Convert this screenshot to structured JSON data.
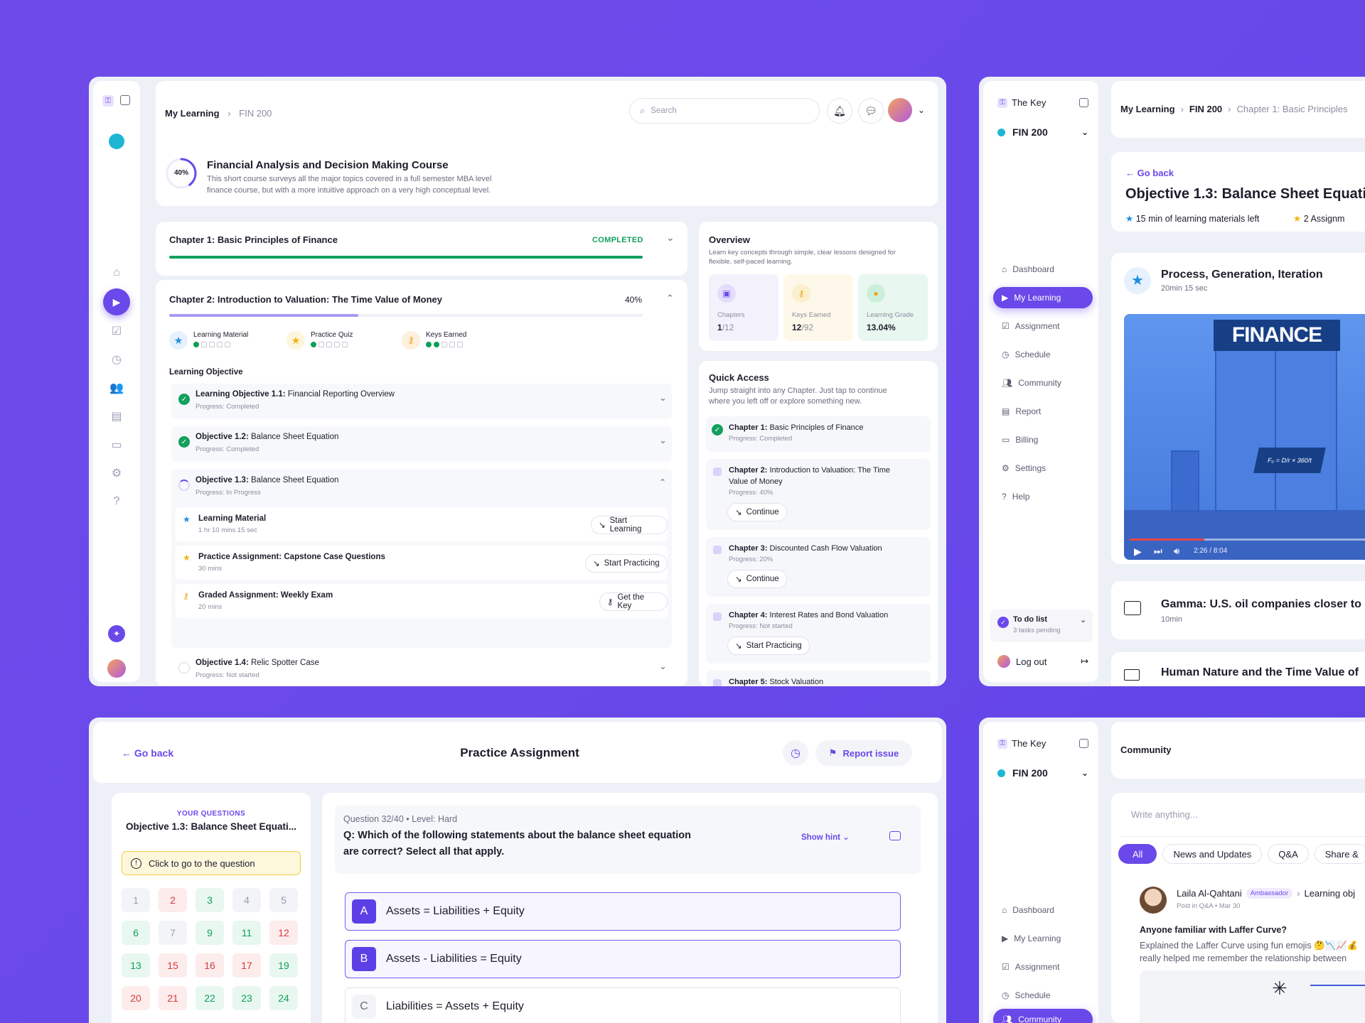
{
  "colors": {
    "accent": "#6a48ea",
    "success": "#12a05c",
    "background": "#6e4ae9"
  },
  "p1": {
    "breadcrumb": {
      "root": "My Learning",
      "current": "FIN 200"
    },
    "search_placeholder": "Search",
    "course": {
      "progress": "40%",
      "progress_value": 0.4,
      "title": "Financial Analysis and Decision Making Course",
      "desc1": "This short course surveys all the major topics covered in a full semester MBA level",
      "desc2": "finance course, but with a more intuitive approach on a very high conceptual level."
    },
    "ch1": {
      "title": "Chapter 1: Basic Principles of Finance",
      "status": "COMPLETED",
      "progress_value": 1.0
    },
    "ch2": {
      "title": "Chapter 2: Introduction to Valuation: The Time Value of Money",
      "percent": "40%",
      "progress_value": 0.4,
      "stats": [
        {
          "label": "Learning Material",
          "icon": "star-icon",
          "filled": 1
        },
        {
          "label": "Practice Quiz",
          "icon": "star-icon",
          "filled": 1
        },
        {
          "label": "Keys Earned",
          "icon": "key-icon",
          "filled": 2
        }
      ],
      "lo_heading": "Learning Objective",
      "objectives": [
        {
          "name": "Learning Objective 1.1:",
          "title": "Financial Reporting Overview",
          "status": "Progress: Completed"
        },
        {
          "name": "Objective 1.2:",
          "title": "Balance Sheet Equation",
          "status": "Progress: Completed"
        },
        {
          "name": "Objective 1.3:",
          "title": "Balance Sheet Equation",
          "status": "Progress: In Progress"
        },
        {
          "name": "Objective 1.4:",
          "title": "Relic Spotter Case",
          "status": "Progress: Not started"
        }
      ],
      "tasks": [
        {
          "title": "Learning Material",
          "sub": "1 hr 10 mins 15 sec",
          "action": "Start Learning"
        },
        {
          "title": "Practice Assignment: Capstone Case Questions",
          "sub": "30 mins",
          "action": "Start Practicing"
        },
        {
          "title": "Graded Assignment: Weekly Exam",
          "sub": "20 mins",
          "action": "Get the Key"
        }
      ]
    },
    "overview": {
      "title": "Overview",
      "desc1": "Learn key concepts through simple, clear lessons designed for",
      "desc2": "flexible, self-paced learning.",
      "tiles": [
        {
          "label": "Chapters",
          "value": "1",
          "total": "/12"
        },
        {
          "label": "Keys Earned",
          "value": "12",
          "total": "/92"
        },
        {
          "label": "Learning Grade",
          "value": "13.04%",
          "total": ""
        }
      ]
    },
    "quick": {
      "title": "Quick Access",
      "desc1": "Jump straight into any Chapter. Just tap to continue",
      "desc2": "where you left off or explore something new.",
      "items": [
        {
          "bold": "Chapter 1:",
          "title": "Basic Principles of Finance",
          "sub": "Progress: Completed",
          "action": ""
        },
        {
          "bold": "Chapter 2:",
          "title": "Introduction to Valuation: The Time",
          "title2": "Value of Money",
          "sub": "Progress: 40%",
          "action": "Continue"
        },
        {
          "bold": "Chapter 3:",
          "title": "Discounted Cash Flow Valuation",
          "sub": "Progress: 20%",
          "action": "Continue"
        },
        {
          "bold": "Chapter 4:",
          "title": "Interest Rates and Bond Valuation",
          "sub": "Progress: Not started",
          "action": "Start Practicing"
        },
        {
          "bold": "Chapter 5:",
          "title": "Stock Valuation"
        }
      ]
    }
  },
  "p2": {
    "brand": "The Key",
    "course": "FIN 200",
    "nav": [
      "Dashboard",
      "My Learning",
      "Assignment",
      "Schedule",
      "Community",
      "Report",
      "Billing",
      "Settings",
      "Help"
    ],
    "todo": {
      "title": "To do list",
      "sub": "3 tasks pending"
    },
    "logout": "Log out",
    "breadcrumb": [
      "My Learning",
      "FIN 200",
      "Chapter 1: Basic Principles"
    ],
    "go_back": "Go back",
    "title": "Objective 1.3: Balance Sheet Equati",
    "meta1": "15 min of learning materials left",
    "meta2": "2 Assignm",
    "lesson": {
      "title": "Process, Generation, Iteration",
      "sub": "20min 15 sec"
    },
    "video": {
      "banner": "FINANCE",
      "time": "2:26 / 8:04",
      "formula": "F₀ = D/r × 360/t",
      "progress_value": 0.28
    },
    "items": [
      {
        "title": "Gamma: U.S. oil companies closer to",
        "sub": "10min"
      },
      {
        "title": "Human Nature and the Time Value of"
      }
    ]
  },
  "p3": {
    "go_back": "Go back",
    "title": "Practice Assignment",
    "report": "Report issue",
    "side": {
      "label": "YOUR QUESTIONS",
      "title": "Objective 1.3: Balance Sheet Equati...",
      "hint": "Click to go to the question",
      "numbers": [
        "1",
        "2",
        "3",
        "4",
        "5",
        "6",
        "7",
        "9",
        "11",
        "12",
        "13",
        "15",
        "16",
        "17",
        "19",
        "20",
        "21",
        "22",
        "23",
        "24"
      ]
    },
    "question": {
      "meta": "Question 32/40",
      "level": "Level: Hard",
      "text1": "Q: Which of the following statements about the balance sheet equation",
      "text2": "are correct? Select all that apply.",
      "hint": "Show hint"
    },
    "options": [
      {
        "letter": "A",
        "text": "Assets = Liabilities + Equity"
      },
      {
        "letter": "B",
        "text": "Assets - Liabilities = Equity"
      },
      {
        "letter": "C",
        "text": "Liabilities = Assets + Equity"
      }
    ]
  },
  "p4": {
    "brand": "The Key",
    "course": "FIN 200",
    "nav": [
      "Dashboard",
      "My Learning",
      "Assignment",
      "Schedule",
      "Community"
    ],
    "title": "Community",
    "placeholder": "Write anything...",
    "filters": [
      "All",
      "News and Updates",
      "Q&A",
      "Share &"
    ],
    "post": {
      "author": "Laila Al-Qahtani",
      "badge": "Ambassador",
      "topic": "Learning obj",
      "meta": "Post in Q&A • Mar 30",
      "title": "Anyone familiar with Laffer Curve?",
      "line1": "Explained the Laffer Curve using fun emojis 🤔📉📈💰",
      "line2": "really helped me remember the relationship between"
    }
  }
}
